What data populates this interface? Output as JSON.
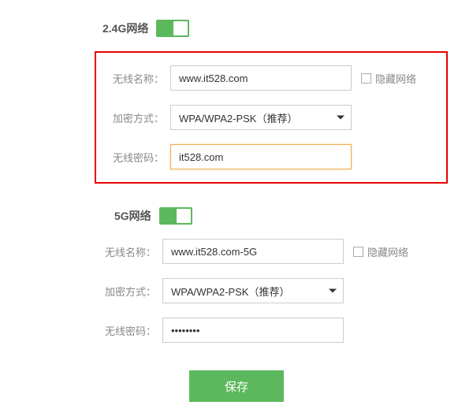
{
  "band24": {
    "title": "2.4G网络",
    "toggle": true,
    "ssid": {
      "label": "无线名称：",
      "value": "www.it528.com"
    },
    "encryption": {
      "label": "加密方式：",
      "value": "WPA/WPA2-PSK（推荐）"
    },
    "password": {
      "label": "无线密码：",
      "value": "it528.com"
    },
    "hide": {
      "label": "隐藏网络",
      "checked": false
    }
  },
  "band5": {
    "title": "5G网络",
    "toggle": true,
    "ssid": {
      "label": "无线名称：",
      "value": "www.it528.com-5G"
    },
    "encryption": {
      "label": "加密方式：",
      "value": "WPA/WPA2-PSK（推荐）"
    },
    "password": {
      "label": "无线密码：",
      "value": "••••••••"
    },
    "hide": {
      "label": "隐藏网络",
      "checked": false
    }
  },
  "actions": {
    "save": "保存"
  }
}
